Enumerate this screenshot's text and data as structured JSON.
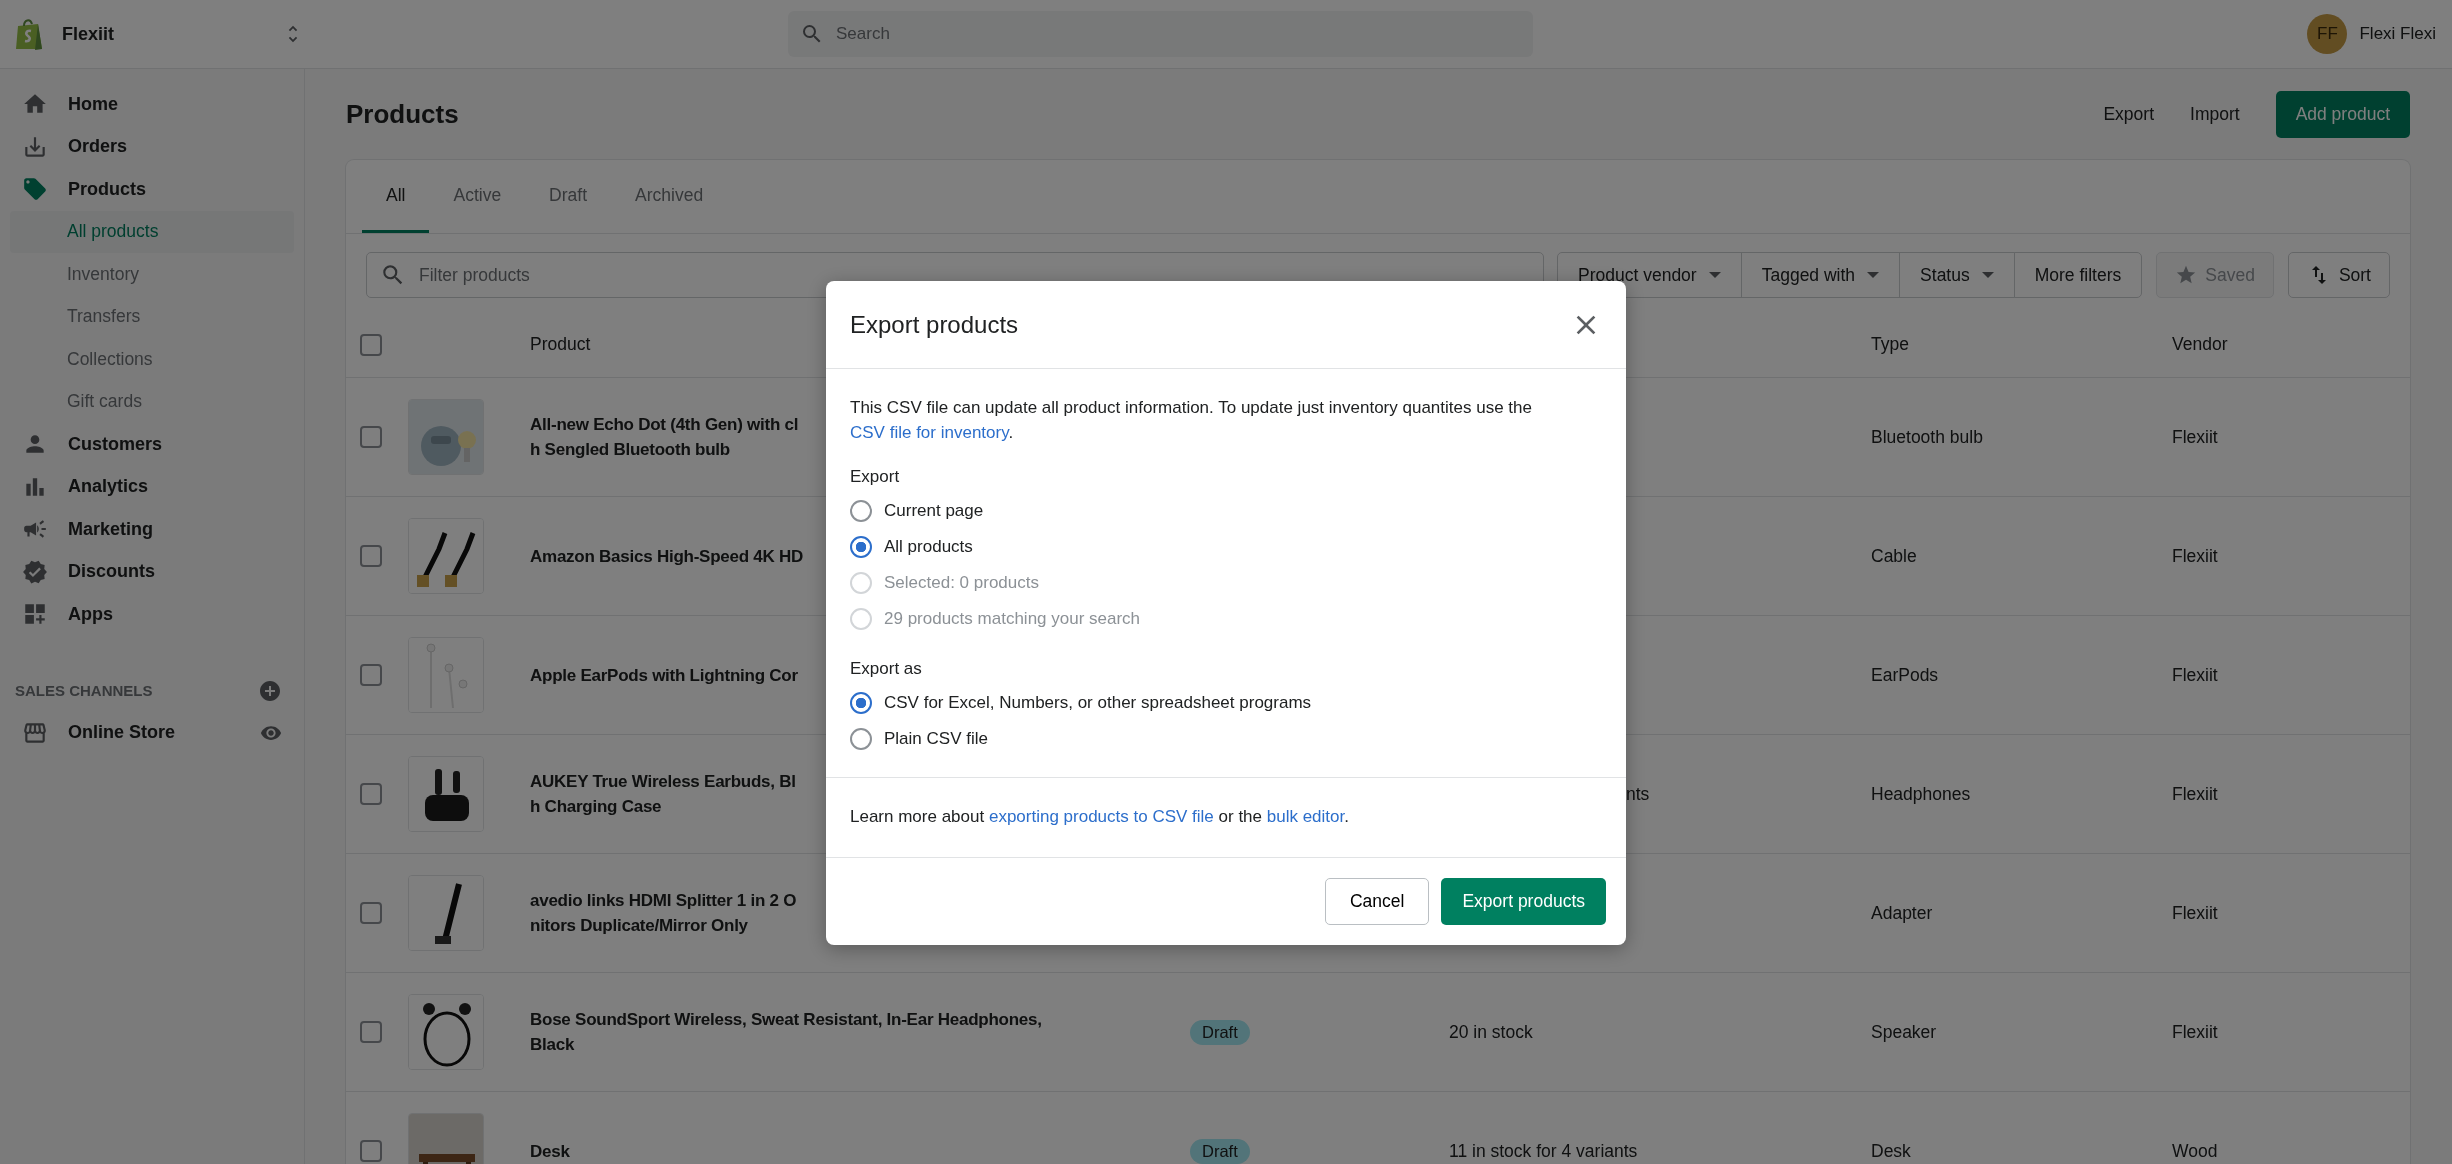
{
  "store": {
    "name": "Flexiit"
  },
  "search": {
    "placeholder": "Search"
  },
  "user": {
    "initials": "FF",
    "name": "Flexi Flexi"
  },
  "sidebar": {
    "items": [
      {
        "label": "Home",
        "selected": false
      },
      {
        "label": "Orders",
        "selected": false
      },
      {
        "label": "Products",
        "selected": true,
        "children": [
          {
            "label": "All products",
            "selected": true
          },
          {
            "label": "Inventory",
            "selected": false
          },
          {
            "label": "Transfers",
            "selected": false
          },
          {
            "label": "Collections",
            "selected": false
          },
          {
            "label": "Gift cards",
            "selected": false
          }
        ]
      },
      {
        "label": "Customers",
        "selected": false
      },
      {
        "label": "Analytics",
        "selected": false
      },
      {
        "label": "Marketing",
        "selected": false
      },
      {
        "label": "Discounts",
        "selected": false
      },
      {
        "label": "Apps",
        "selected": false
      }
    ],
    "sales_channels": {
      "heading": "SALES CHANNELS",
      "items": [
        {
          "label": "Online Store"
        }
      ]
    }
  },
  "page": {
    "title": "Products",
    "actions": [
      "Export",
      "Import"
    ],
    "primary_action": "Add product"
  },
  "tabs": [
    {
      "label": "All",
      "selected": true
    },
    {
      "label": "Active",
      "selected": false
    },
    {
      "label": "Draft",
      "selected": false
    },
    {
      "label": "Archived",
      "selected": false
    }
  ],
  "filters": {
    "placeholder": "Filter products",
    "dropdowns": [
      {
        "label": "Product vendor",
        "caret": true
      },
      {
        "label": "Tagged with",
        "caret": true
      },
      {
        "label": "Status",
        "caret": true
      },
      {
        "label": "More filters",
        "caret": false
      }
    ],
    "saved": {
      "label": "Saved",
      "disabled": true
    },
    "sort": "Sort"
  },
  "table": {
    "columns": [
      "Product",
      "Type",
      "Vendor"
    ],
    "select_all": {
      "checked": false
    },
    "rows": [
      {
        "checked": false,
        "image": {
          "kind": "picture"
        },
        "name_lines": [
          "All-new Echo Dot (4th Gen) with cl",
          "h Sengled Bluetooth bulb"
        ],
        "type": "Bluetooth bulb",
        "vendor": "Flexiit"
      },
      {
        "checked": false,
        "image": {
          "kind": "picture"
        },
        "name_lines": [
          "Amazon Basics High-Speed 4K HD"
        ],
        "type": "Cable",
        "vendor": "Flexiit"
      },
      {
        "checked": false,
        "image": {
          "kind": "picture"
        },
        "name_lines": [
          "Apple EarPods with Lightning Cor"
        ],
        "type": "EarPods",
        "vendor": "Flexiit"
      },
      {
        "checked": false,
        "image": {
          "kind": "picture"
        },
        "name_lines": [
          "AUKEY True Wireless Earbuds, Bl",
          "h Charging Case"
        ],
        "inventory": "nts",
        "inventory_cut": true,
        "type": "Headphones",
        "vendor": "Flexiit"
      },
      {
        "checked": false,
        "image": {
          "kind": "picture"
        },
        "name_lines": [
          "avedio links HDMI Splitter 1 in 2 O",
          "nitors Duplicate/Mirror Only"
        ],
        "type": "Adapter",
        "vendor": "Flexiit"
      },
      {
        "checked": false,
        "image": {
          "kind": "picture"
        },
        "name_lines": [
          "Bose SoundSport Wireless, Sweat Resistant, In-Ear Headphones,",
          "Black"
        ],
        "status": "Draft",
        "inventory": "20 in stock",
        "type": "Speaker",
        "vendor": "Flexiit"
      },
      {
        "checked": false,
        "image": {
          "kind": "picture"
        },
        "name_lines": [
          "Desk"
        ],
        "status": "Draft",
        "inventory": "11 in stock for 4 variants",
        "type": "Desk",
        "vendor": "Wood"
      }
    ]
  },
  "modal": {
    "title": "Export products",
    "intro": "This CSV file can update all product information. To update just inventory quantites use the",
    "intro_link": "CSV file for inventory",
    "intro_end": ".",
    "export_label": "Export",
    "export_options": [
      {
        "label": "Current page",
        "selected": false,
        "disabled": false
      },
      {
        "label": "All products",
        "selected": true,
        "disabled": false
      },
      {
        "label": "Selected: 0 products",
        "selected": false,
        "disabled": true
      },
      {
        "label": "29 products matching your search",
        "selected": false,
        "disabled": true
      }
    ],
    "format_label": "Export as",
    "format_options": [
      {
        "label": "CSV for Excel, Numbers, or other spreadsheet programs",
        "selected": true,
        "disabled": false
      },
      {
        "label": "Plain CSV file",
        "selected": false,
        "disabled": false
      }
    ],
    "learn": [
      "Learn more about ",
      "exporting products to CSV file",
      " or the ",
      "bulk editor",
      "."
    ],
    "cancel": "Cancel",
    "confirm": "Export products"
  }
}
